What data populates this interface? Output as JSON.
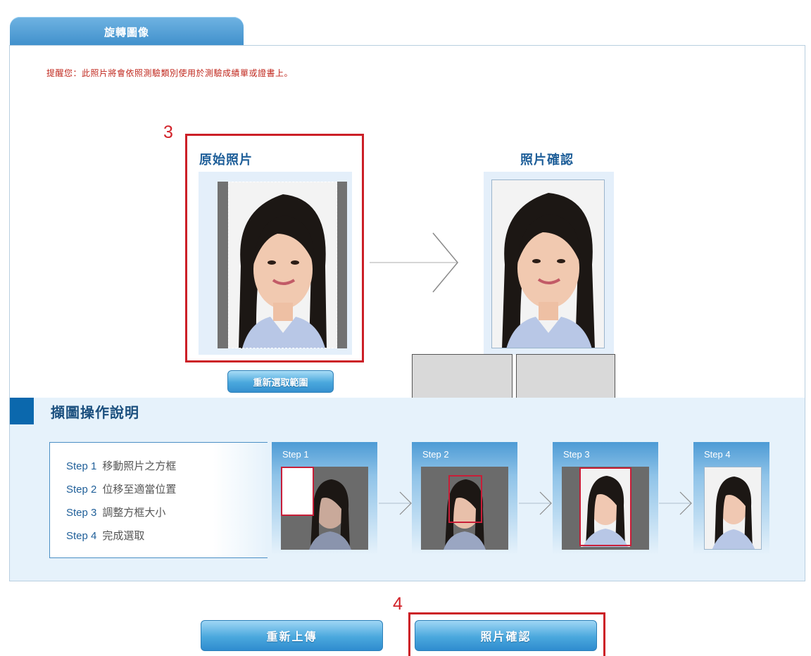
{
  "tab": {
    "label": "旋轉圖像"
  },
  "notice": "提醒您：此照片將會依照測驗類別使用於測驗成績單或證書上。",
  "annotations": {
    "marker_3": "3",
    "marker_4": "4"
  },
  "original": {
    "title": "原始照片",
    "reselect_button": "重新選取範圍"
  },
  "confirm": {
    "title": "照片確認"
  },
  "instructions": {
    "title": "擷圖操作說明",
    "steps": [
      {
        "label": "Step 1",
        "text": "移動照片之方框"
      },
      {
        "label": "Step 2",
        "text": "位移至適當位置"
      },
      {
        "label": "Step 3",
        "text": "調整方框大小"
      },
      {
        "label": "Step 4",
        "text": "完成選取"
      }
    ],
    "frames": [
      {
        "label": "Step 1"
      },
      {
        "label": "Step 2"
      },
      {
        "label": "Step 3"
      },
      {
        "label": "Step 4"
      }
    ]
  },
  "buttons": {
    "reupload": "重新上傳",
    "confirm_photo": "照片確認"
  },
  "colors": {
    "accent": "#3f8fcb",
    "highlight": "#cc1f27",
    "notice": "#c0271d"
  }
}
